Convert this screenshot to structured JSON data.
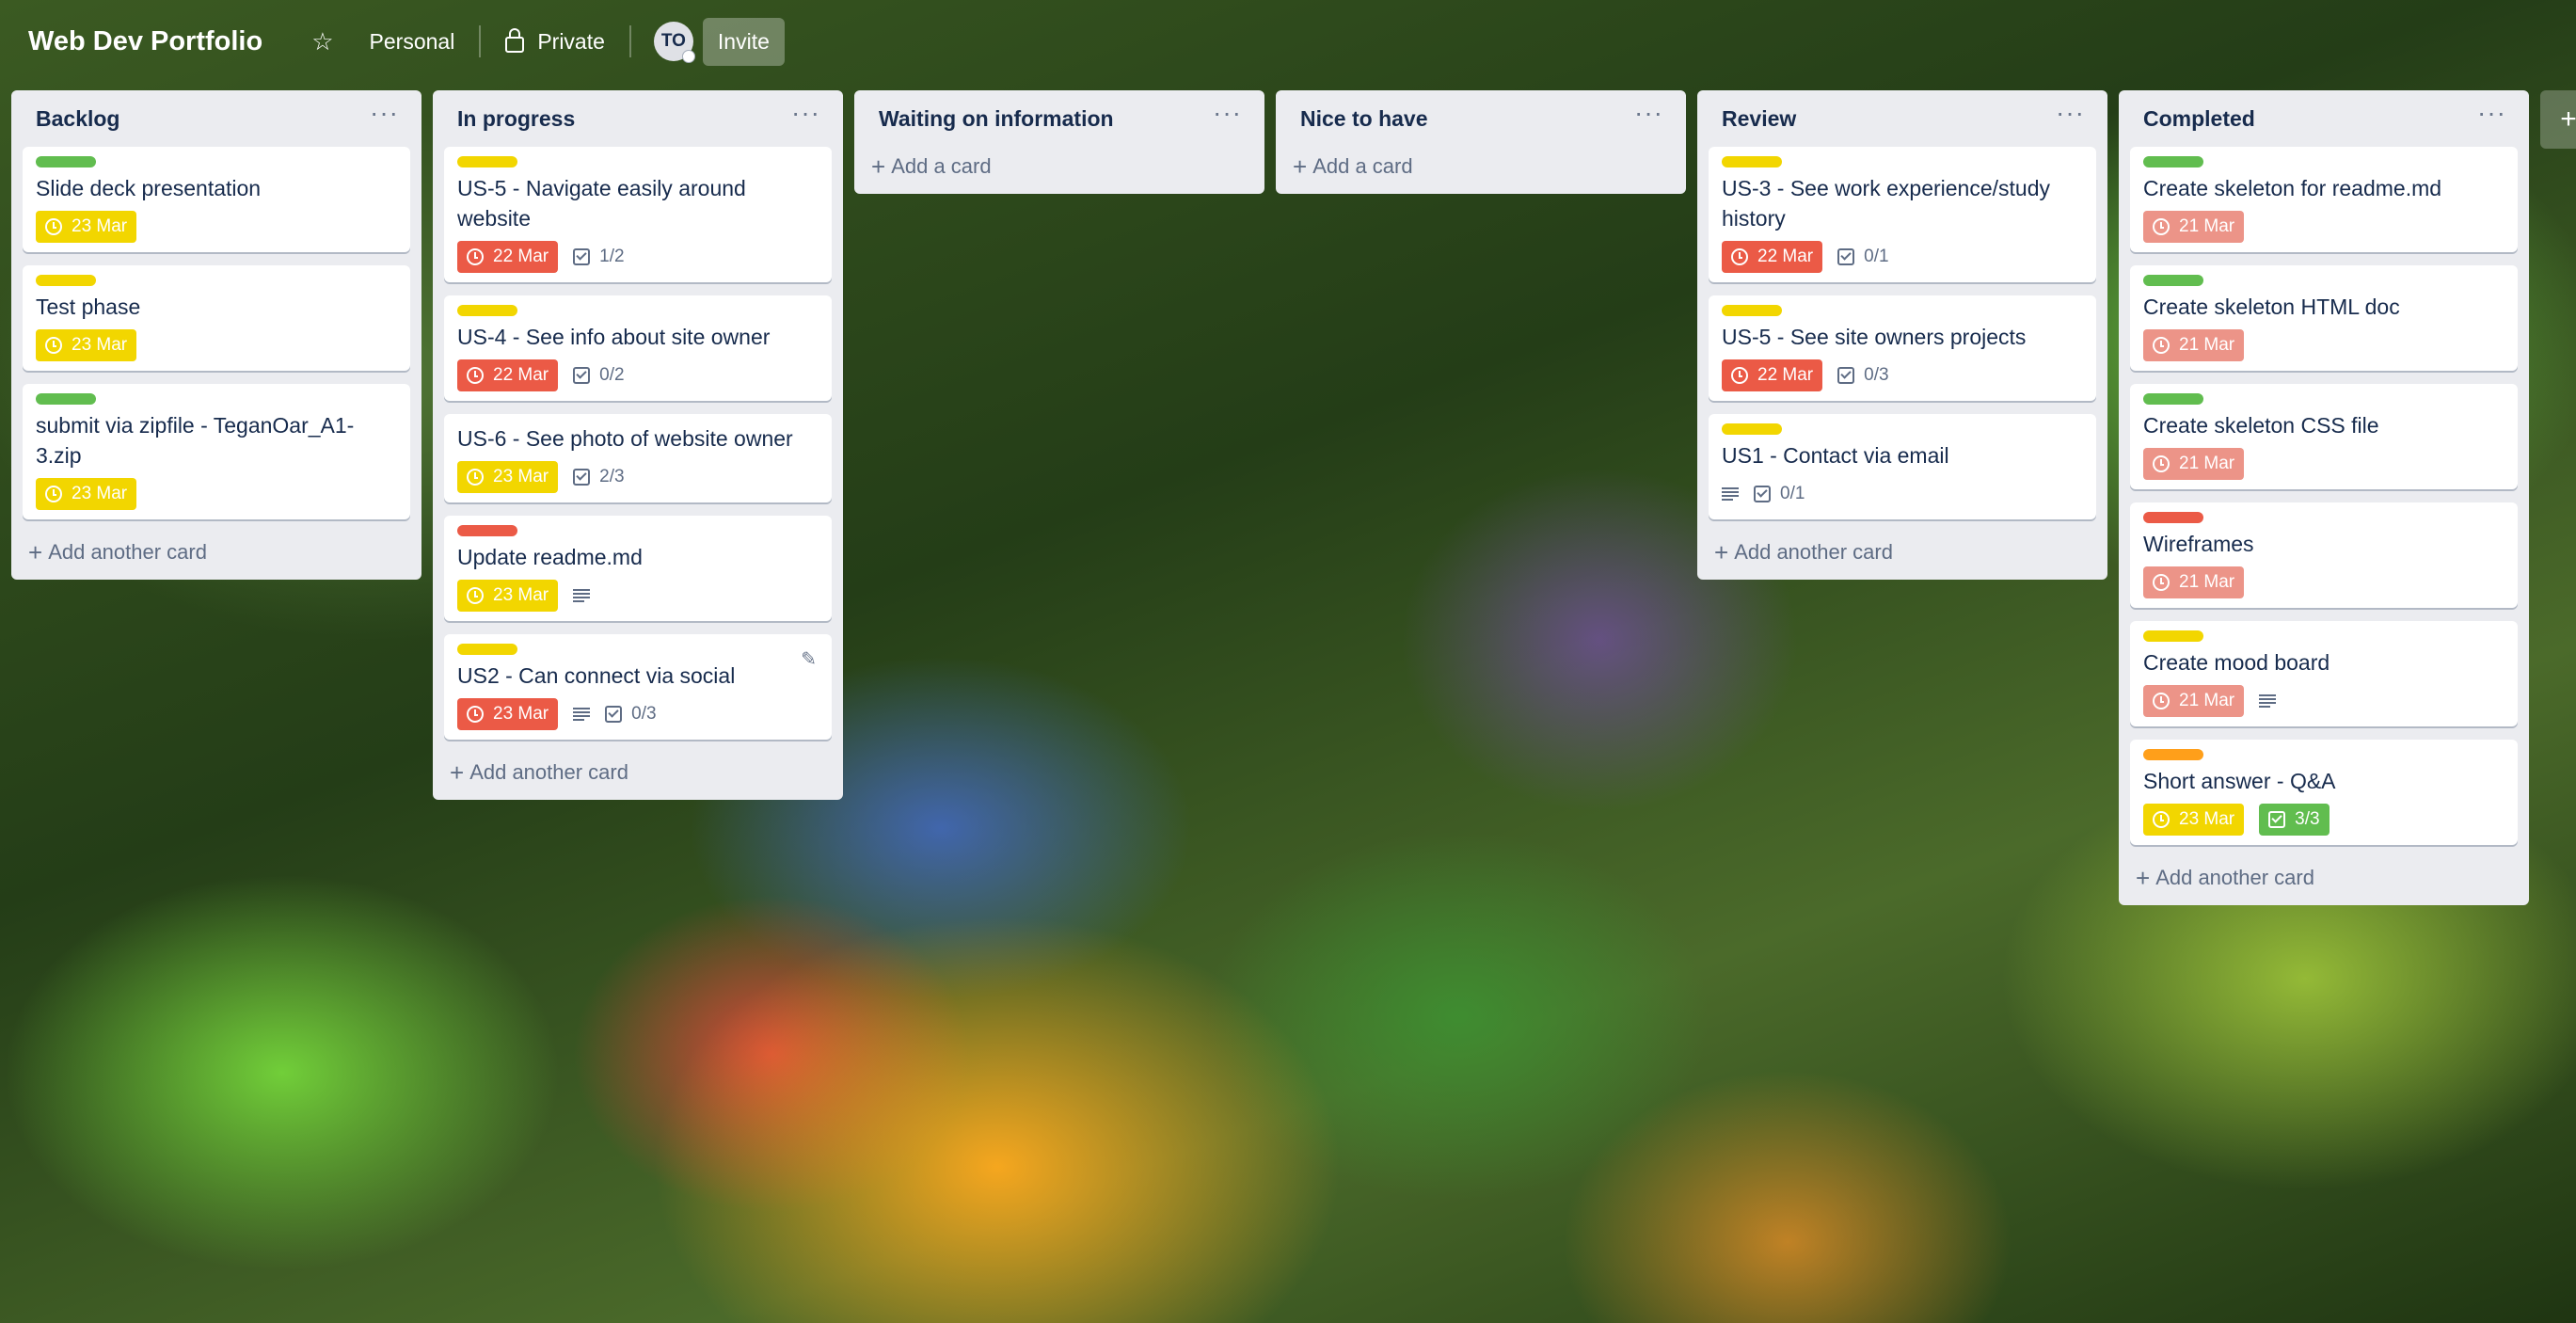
{
  "header": {
    "board_title": "Web Dev Portfolio",
    "star_icon": "star-icon",
    "workspace": "Personal",
    "visibility": "Private",
    "avatar_initials": "TO",
    "invite_label": "Invite"
  },
  "colors": {
    "green": "#61bd4f",
    "yellow": "#f2d600",
    "red": "#eb5a46",
    "orange": "#ff9f1a",
    "due_soon": "#f2d600",
    "overdue": "#eb5a46",
    "overdue_muted": "#ec9488"
  },
  "lists": [
    {
      "title": "Backlog",
      "add_label": "Add another card",
      "cards": [
        {
          "label": "green",
          "title": "Slide deck presentation",
          "due": "23 Mar",
          "due_style": "yellow"
        },
        {
          "label": "yellow",
          "title": "Test phase",
          "due": "23 Mar",
          "due_style": "yellow"
        },
        {
          "label": "green",
          "title": "submit via zipfile - TeganOar_A1-3.zip",
          "due": "23 Mar",
          "due_style": "yellow"
        }
      ]
    },
    {
      "title": "In progress",
      "add_label": "Add another card",
      "cards": [
        {
          "label": "yellow",
          "title": "US-5 - Navigate easily around website",
          "due": "22 Mar",
          "due_style": "red",
          "checklist": "1/2"
        },
        {
          "label": "yellow",
          "title": "US-4 - See info about site owner",
          "due": "22 Mar",
          "due_style": "red",
          "checklist": "0/2"
        },
        {
          "title": "US-6 - See photo of website owner",
          "due": "23 Mar",
          "due_style": "yellow",
          "checklist": "2/3"
        },
        {
          "label": "red",
          "title": "Update readme.md",
          "due": "23 Mar",
          "due_style": "yellow",
          "description": true
        },
        {
          "label": "yellow",
          "title": "US2 - Can connect via social",
          "due": "23 Mar",
          "due_style": "red",
          "description": true,
          "checklist": "0/3",
          "edit": true
        }
      ]
    },
    {
      "title": "Waiting on information",
      "add_label": "Add a card",
      "cards": []
    },
    {
      "title": "Nice to have",
      "add_label": "Add a card",
      "cards": []
    },
    {
      "title": "Review",
      "add_label": "Add another card",
      "cards": [
        {
          "label": "yellow",
          "title": "US-3 - See work experience/study history",
          "due": "22 Mar",
          "due_style": "red",
          "checklist": "0/1"
        },
        {
          "label": "yellow",
          "title": "US-5 - See site owners projects",
          "due": "22 Mar",
          "due_style": "red",
          "checklist": "0/3"
        },
        {
          "label": "yellow",
          "title": "US1 - Contact via email",
          "description": true,
          "checklist": "0/1"
        }
      ]
    },
    {
      "title": "Completed",
      "add_label": "Add another card",
      "cards": [
        {
          "label": "green",
          "title": "Create skeleton for readme.md",
          "due": "21 Mar",
          "due_style": "pink"
        },
        {
          "label": "green",
          "title": "Create skeleton HTML doc",
          "due": "21 Mar",
          "due_style": "pink"
        },
        {
          "label": "green",
          "title": "Create skeleton CSS file",
          "due": "21 Mar",
          "due_style": "pink"
        },
        {
          "label": "red",
          "title": "Wireframes",
          "due": "21 Mar",
          "due_style": "pink"
        },
        {
          "label": "yellow",
          "title": "Create mood board",
          "due": "21 Mar",
          "due_style": "pink",
          "description": true
        },
        {
          "label": "orange",
          "title": "Short answer - Q&A",
          "due": "23 Mar",
          "due_style": "yellow",
          "checklist": "3/3",
          "checklist_complete": true
        }
      ]
    }
  ],
  "add_list_icon": "plus-icon"
}
